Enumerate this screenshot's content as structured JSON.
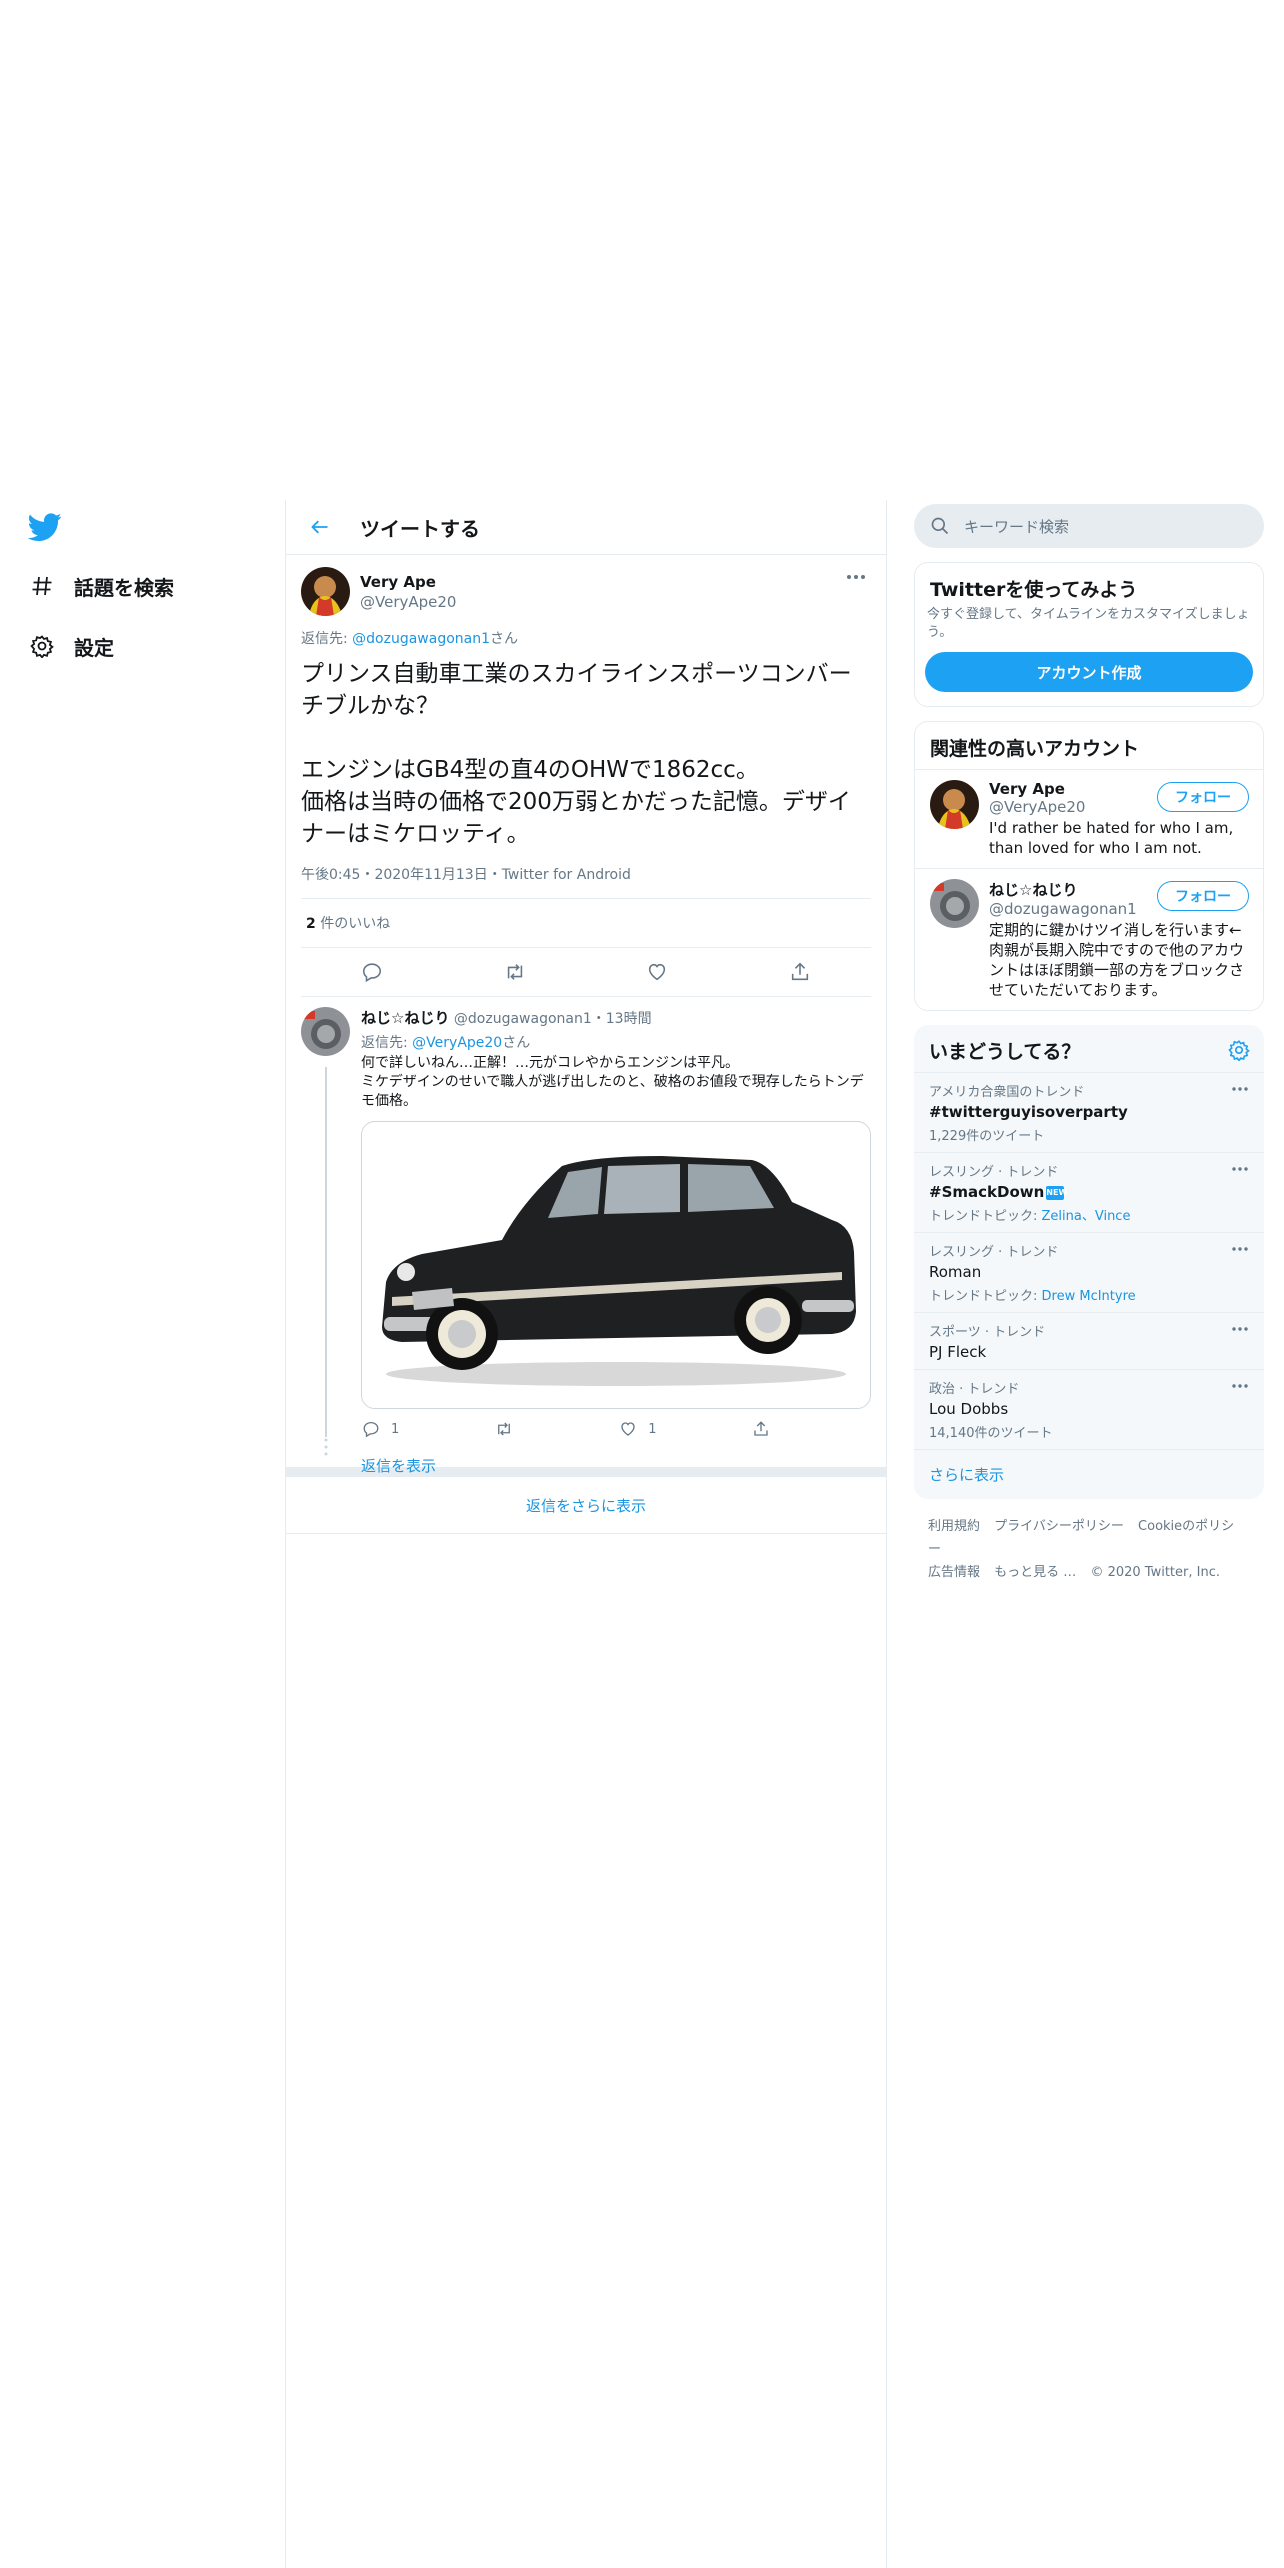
{
  "nav": {
    "items": [
      {
        "label": "話題を検索",
        "icon": "hashtag-icon"
      },
      {
        "label": "設定",
        "icon": "gear-icon"
      }
    ]
  },
  "main": {
    "title": "ツイートする",
    "tweet": {
      "name": "Very Ape",
      "handle": "@VeryApe20",
      "reply_prefix": "返信先: ",
      "reply_user": "@dozugawagonan1",
      "reply_suffix": "さん",
      "body": "プリンス自動車工業のスカイラインスポーツコンバーチブルかな？\n\nエンジンはGB4型の直4のOHWで1862cc。\n価格は当時の価格で200万弱とかだった記憶。デザイナーはミケロッティ。",
      "meta": "午後0:45・2020年11月13日・Twitter for Android",
      "likes_count": "2",
      "likes_label": " 件のいいね"
    },
    "reply": {
      "name": "ねじ☆ねじり",
      "handle": "@dozugawagonan1",
      "time": "・13時間",
      "reply_prefix": "返信先: ",
      "reply_user": "@VeryApe20",
      "reply_suffix": "さん",
      "body": "何で詳しいねん…正解！…元がコレやからエンジンは平凡。\nミケデザインのせいで職人が逃げ出したのと、破格のお値段で現存したらトンデモ価格。",
      "reply_count": "1",
      "like_count": "1",
      "show_replies": "返信を表示"
    },
    "more_replies": "返信をさらに表示"
  },
  "sidebar": {
    "search_placeholder": "キーワード検索",
    "signup": {
      "title": "Twitterを使ってみよう",
      "text": "今すぐ登録して、タイムラインをカスタマイズしましょう。",
      "button": "アカウント作成"
    },
    "relevant": {
      "title": "関連性の高いアカウント",
      "accounts": [
        {
          "name": "Very Ape",
          "handle": "@VeryApe20",
          "bio": "I'd rather be hated for who I am, than loved for who I am not.",
          "follow": "フォロー"
        },
        {
          "name": "ねじ☆ねじり",
          "handle": "@dozugawagonan1",
          "bio": "定期的に鍵かけツイ消しを行います←肉親が長期入院中ですので他のアカウントはほぼ閉鎖一部の方をブロックさせていただいております。",
          "follow": "フォロー"
        }
      ]
    },
    "trends": {
      "title": "いまどうしてる？",
      "items": [
        {
          "category": "アメリカ合衆国のトレンド",
          "name": "#twitterguyisoverparty",
          "sub": "1,229件のツイート"
        },
        {
          "category": "レスリング · トレンド",
          "name": "#SmackDown",
          "sub_prefix": "トレンドトピック: ",
          "sub_link": "Zelina、Vince"
        },
        {
          "category": "レスリング · トレンド",
          "name": "Roman",
          "sub_prefix": "トレンドトピック: ",
          "sub_link": "Drew McIntyre"
        },
        {
          "category": "スポーツ · トレンド",
          "name": "PJ Fleck"
        },
        {
          "category": "政治 · トレンド",
          "name": "Lou Dobbs",
          "sub": "14,140件のツイート"
        }
      ],
      "show_more": "さらに表示",
      "new_tag": "NEW"
    },
    "footer": {
      "links": [
        "利用規約",
        "プライバシーポリシー",
        "Cookieのポリシー",
        "広告情報",
        "もっと見る …"
      ],
      "copyright": "© 2020 Twitter, Inc."
    }
  }
}
